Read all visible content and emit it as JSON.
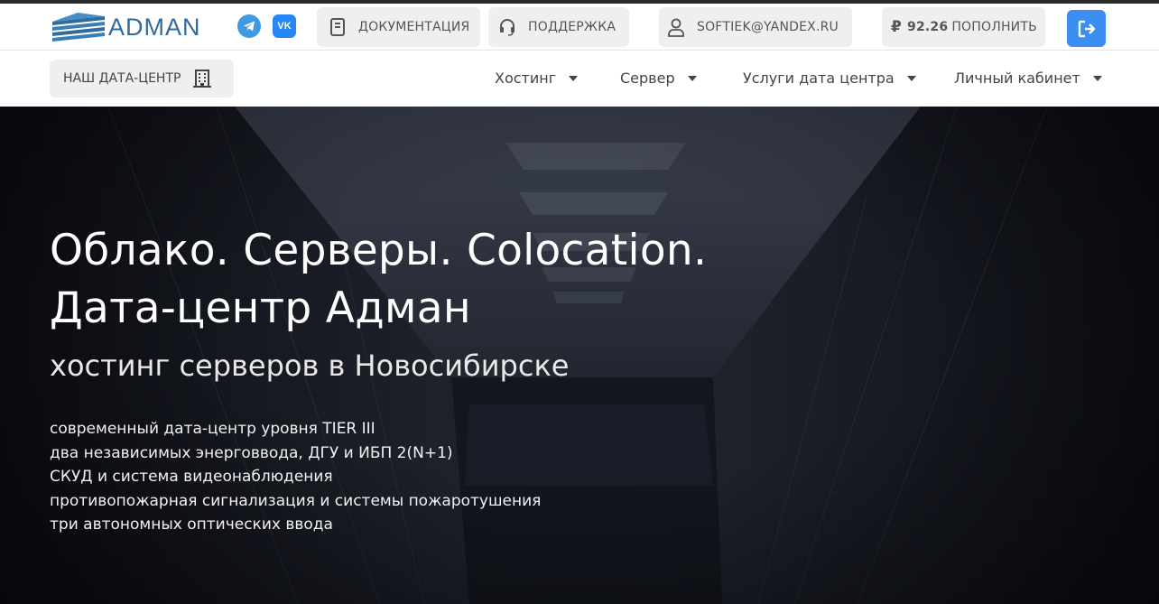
{
  "header": {
    "logo_text": "ADMAN",
    "social": {
      "telegram_icon": "telegram-icon",
      "vk_label": "VK"
    },
    "docs_label": "ДОКУМЕНТАЦИЯ",
    "support_label": "ПОДДЕРЖКА",
    "user_email": "SOFTIEK@YANDEX.RU",
    "balance": {
      "currency_symbol": "₽",
      "amount": "92.26",
      "topup_label": "ПОПОЛНИТЬ"
    }
  },
  "nav": {
    "datacenter_button": "НАШ ДАТА-ЦЕНТР",
    "items": [
      {
        "label": "Хостинг"
      },
      {
        "label": "Сервер"
      },
      {
        "label": "Услуги дата центра"
      },
      {
        "label": "Личный кабинет"
      }
    ]
  },
  "hero": {
    "title_line1": "Облако. Серверы. Colocation.",
    "title_line2": "Дата-центр Адман",
    "subtitle": "хостинг серверов в Новосибирске",
    "features": [
      "современный дата-центр уровня TIER III",
      "два независимых энерговвода, ДГУ и ИБП 2(N+1)",
      "СКУД и система видеонаблюдения",
      "противопожарная сигнализация и системы пожаротушения",
      "три автономных оптических ввода"
    ]
  },
  "colors": {
    "brand_blue": "#2e6c9f",
    "logout_button": "#3b8ff0",
    "telegram": "#3d9ae3",
    "vk": "#2787f5",
    "pill_bg": "#efefef"
  }
}
